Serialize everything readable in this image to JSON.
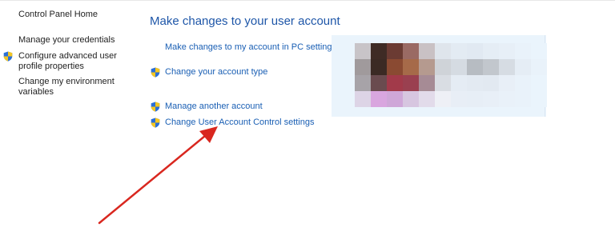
{
  "nav": {
    "home": "Control Panel Home",
    "credentials": "Manage your credentials",
    "advanced_profile": "Configure advanced user profile properties",
    "environment": "Change my environment variables"
  },
  "main": {
    "title": "Make changes to your user account",
    "pc_settings_link": "Make changes to my account in PC settings",
    "account_type_link": "Change your account type",
    "another_account_link": "Manage another account",
    "uac_link": "Change User Account Control settings"
  },
  "avatar": {
    "description": "blurred account picture",
    "colors": [
      "#c8c4c8",
      "#3f2b25",
      "#6b3b33",
      "#9a6a64",
      "#c9c1c4",
      "#dfe5ec",
      "#e3ebf3",
      "#e1e9f2",
      "#e5edf5",
      "#e7eff7",
      "#e9f2fa",
      "#eaf4fc",
      "#a09a9c",
      "#3b2a24",
      "#8a4a32",
      "#a66a49",
      "#b59a8f",
      "#cfd3d8",
      "#d5dbe2",
      "#b7bcc2",
      "#c2c7cd",
      "#d6dce3",
      "#e5edf5",
      "#e9f2fa",
      "#a7a3a8",
      "#6a4b4f",
      "#a23a4a",
      "#9a4050",
      "#a68b95",
      "#d9dde3",
      "#e5ecf4",
      "#e3eaf2",
      "#e2e9f1",
      "#e8eff7",
      "#e9f2fa",
      "#eaf4fc",
      "#ddd4e6",
      "#d9a6df",
      "#cfa7d8",
      "#d7c6e0",
      "#e2dbea",
      "#eef0f6",
      "#e8eef6",
      "#e7eef6",
      "#e8eff7",
      "#e9f1f9",
      "#e9f2fa",
      "#eaf4fc"
    ]
  },
  "colors": {
    "link": "#1a5fb4",
    "title": "#1e56a8",
    "arrow": "#d9271f",
    "panel": "#eaf4fc"
  }
}
